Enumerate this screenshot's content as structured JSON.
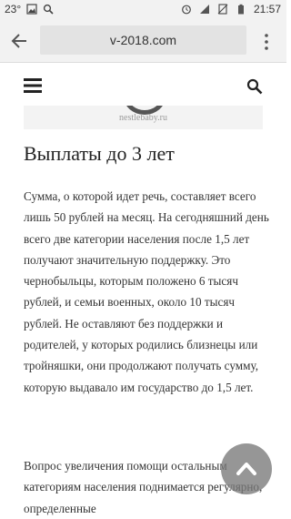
{
  "status_bar": {
    "temperature": "23°",
    "time": "21:57"
  },
  "browser": {
    "url": "v-2018.com"
  },
  "article": {
    "image_caption": "nestlebaby.ru",
    "heading": "Выплаты до 3 лет",
    "paragraph_1": "Сумма, о которой идет речь, составляет всего лишь 50 рублей на месяц. На сегодняшний день всего две категории населения после 1,5 лет получают значительную поддержку. Это чернобыльцы, которым положено 6 тысяч рублей, и семьи военных, около 10 тысяч рублей. Не оставляют без поддержки и родителей, у которых родились близнецы или тройняшки, они продолжают получать сумму, которую выдавало им государство до 1,5 лет.",
    "paragraph_2": "Вопрос увеличения помощи остальным категориям населения поднимается регулярно, определенные"
  },
  "icons": {
    "status": [
      "image-icon",
      "search-icon",
      "alarm-icon",
      "signal-icon",
      "no-sim-icon",
      "battery-icon"
    ],
    "browser": [
      "back-arrow-icon",
      "overflow-menu-icon"
    ],
    "site": [
      "hamburger-menu-icon",
      "search-icon",
      "chevron-up-icon"
    ]
  }
}
